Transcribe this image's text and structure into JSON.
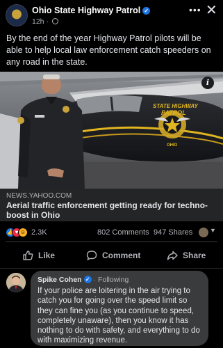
{
  "header": {
    "page_name": "Ohio State Highway Patrol",
    "time": "12h",
    "dot": "·",
    "more_label": "•••",
    "close_label": "✕"
  },
  "post": {
    "text": "By the end of the year Highway Patrol pilots will be able to help local law enforcement catch speeders on any road in the state."
  },
  "media": {
    "plane_text_line1": "STATE HIGHWAY",
    "plane_text_line2": "PATROL",
    "plane_text_line3": "OHIO",
    "info_label": "i"
  },
  "link": {
    "source": "NEWS.YAHOO.COM",
    "title": "Aerial traffic enforcement getting ready for techno-boost in Ohio"
  },
  "stats": {
    "reactions": "2.3K",
    "comments": "802 Comments",
    "shares": "947 Shares",
    "caret": "▼"
  },
  "actions": {
    "like": "Like",
    "comment": "Comment",
    "share": "Share"
  },
  "comment": {
    "author": "Spike Cohen",
    "follow": "· Following",
    "text": "If your police are loitering in the air trying to catch you for going over the speed limit so they can fine you (as you continue to speed, completely unaware), then you know it has nothing to do with safety, and everything to do with maximizing revenue."
  },
  "colors": {
    "background": "#000000",
    "card": "#242526",
    "bubble": "#3a3b3c",
    "verified": "#1b74e4",
    "plane_stripe": "#e0b520"
  },
  "icons": [
    "verified-badge-icon",
    "globe-icon",
    "more-icon",
    "close-icon",
    "info-icon",
    "like-reaction-icon",
    "love-reaction-icon",
    "wow-reaction-icon",
    "thumbs-up-icon",
    "comment-icon",
    "share-icon"
  ]
}
